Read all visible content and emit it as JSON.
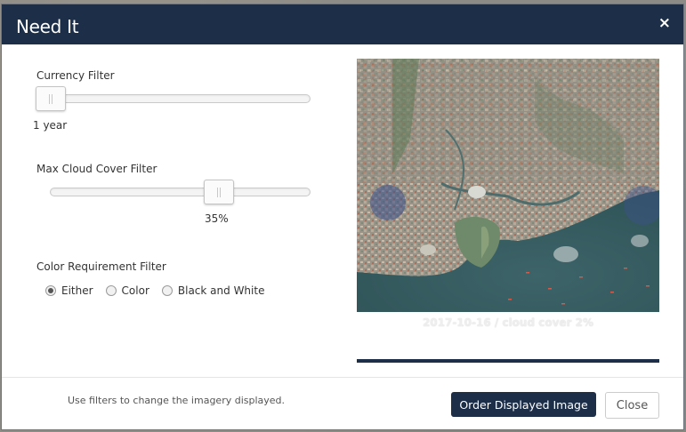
{
  "modal": {
    "title": "Need It",
    "close_glyph": "×"
  },
  "filters": {
    "currency": {
      "label": "Currency Filter",
      "value_text": "1 year",
      "value_fraction": 0.0
    },
    "cloud_cover": {
      "label": "Max Cloud Cover Filter",
      "value_text": "35%",
      "value_percent": 35
    },
    "color_requirement": {
      "label": "Color Requirement Filter",
      "options": [
        {
          "label": "Either",
          "selected": true
        },
        {
          "label": "Color",
          "selected": false
        },
        {
          "label": "Black and White",
          "selected": false
        }
      ]
    }
  },
  "preview": {
    "caption": "2017-10-16 / cloud cover 2%"
  },
  "footer": {
    "note": "Use filters to change the imagery displayed.",
    "order_label": "Order Displayed Image",
    "close_label": "Close"
  },
  "colors": {
    "header_bg": "#1c2e48",
    "primary_button": "#1c2e48"
  },
  "icons": {
    "close": "close-icon",
    "slider_grip": "grip-icon"
  }
}
